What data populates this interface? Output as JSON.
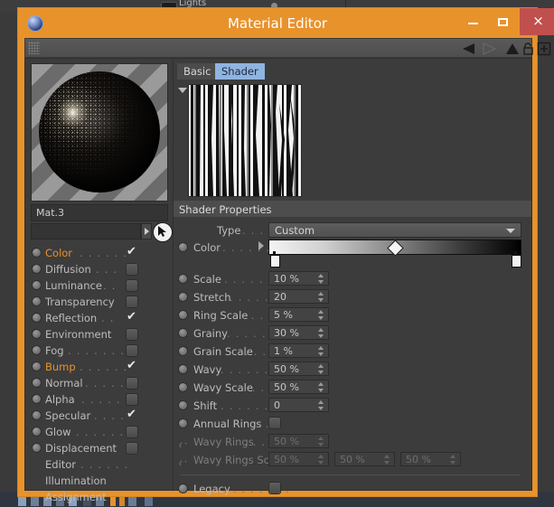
{
  "background": {
    "light_label": "Lights"
  },
  "window": {
    "title": "Material Editor",
    "controls": {
      "minimize": "minimize-button",
      "maximize": "maximize-button",
      "close": "×"
    }
  },
  "toolbar": {
    "icons": [
      "back-arrow-icon",
      "forward-arrow-icon",
      "up-arrow-icon",
      "unlock-icon",
      "add-icon"
    ]
  },
  "left_panel": {
    "material_name": "Mat.3",
    "link_field_value": "",
    "channels": [
      {
        "label": "Color",
        "leader": ". . . . . .",
        "checked": true,
        "highlight": false
      },
      {
        "label": "Diffusion",
        "leader": ". . .",
        "checked": false,
        "highlight": false
      },
      {
        "label": "Luminance",
        "leader": ". .",
        "checked": false,
        "highlight": false
      },
      {
        "label": "Transparency",
        "leader": "",
        "checked": false,
        "highlight": false
      },
      {
        "label": "Reflection",
        "leader": ". .",
        "checked": true,
        "highlight": false
      },
      {
        "label": "Environment",
        "leader": "",
        "checked": false,
        "highlight": false
      },
      {
        "label": "Fog",
        "leader": ". . . . . . .",
        "checked": false,
        "highlight": false
      },
      {
        "label": "Bump",
        "leader": ". . . . . .",
        "checked": true,
        "highlight": true
      },
      {
        "label": "Normal",
        "leader": ". . . . .",
        "checked": false,
        "highlight": false
      },
      {
        "label": "Alpha",
        "leader": ". . . . . .",
        "checked": false,
        "highlight": false
      },
      {
        "label": "Specular",
        "leader": ". . . .",
        "checked": true,
        "highlight": false
      },
      {
        "label": "Glow",
        "leader": ". . . . . . .",
        "checked": false,
        "highlight": false
      },
      {
        "label": "Displacement",
        "leader": "",
        "checked": false,
        "highlight": false
      }
    ],
    "links": [
      {
        "label": "Editor",
        "leader": ". . . . . ."
      },
      {
        "label": "Illumination",
        "leader": ""
      },
      {
        "label": "Assignment",
        "leader": ""
      }
    ]
  },
  "right_panel": {
    "tabs": [
      {
        "label": "Basic",
        "active": false
      },
      {
        "label": "Shader",
        "active": true
      }
    ],
    "section_title": "Shader Properties",
    "type_row": {
      "label": "Type",
      "leader": ". . . . . . . . . .",
      "value": "Custom"
    },
    "color_row": {
      "label": "Color",
      "leader": ". . . . . . .",
      "gradient_start": "#f4f4f4",
      "gradient_end": "#000000"
    },
    "properties": [
      {
        "label": "Scale",
        "leader": ". . . . . . . . .",
        "value": "10 %",
        "disabled": false
      },
      {
        "label": "Stretch",
        "leader": ". . . . . . . .",
        "value": "20",
        "disabled": false
      },
      {
        "label": "Ring Scale",
        "leader": ". . . . .",
        "value": "5 %",
        "disabled": false
      },
      {
        "label": "Grainy",
        "leader": ". . . . . . . .",
        "value": "30 %",
        "disabled": false
      },
      {
        "label": "Grain Scale",
        "leader": ". . . . .",
        "value": "1 %",
        "disabled": false
      },
      {
        "label": "Wavy",
        "leader": ". . . . . . . . .",
        "value": "50 %",
        "disabled": false
      },
      {
        "label": "Wavy Scale",
        "leader": ". . . . .",
        "value": "50 %",
        "disabled": false
      },
      {
        "label": "Shift",
        "leader": ". . . . . . . . .",
        "value": "0",
        "disabled": false
      }
    ],
    "annual_rings": {
      "label": "Annual Rings",
      "leader": ". . .",
      "checked": false
    },
    "wavy_rings": {
      "label": "Wavy Rings",
      "leader": ". . . .",
      "value": "50 %",
      "disabled": true
    },
    "wavy_rings_scale": {
      "label": "Wavy Rings Scale",
      "leader": "",
      "values": [
        "50 %",
        "50 %",
        "50 %"
      ],
      "disabled": true
    },
    "legacy": {
      "label": "Legacy",
      "leader": ". . . . . . . .",
      "checked": false
    }
  },
  "colors": {
    "window_frame": "#e8922c",
    "panel_bg": "#3c3c3c",
    "accent_tab": "#8fb4e0",
    "close_button": "#c0504d",
    "highlight_text": "#e8922c"
  }
}
